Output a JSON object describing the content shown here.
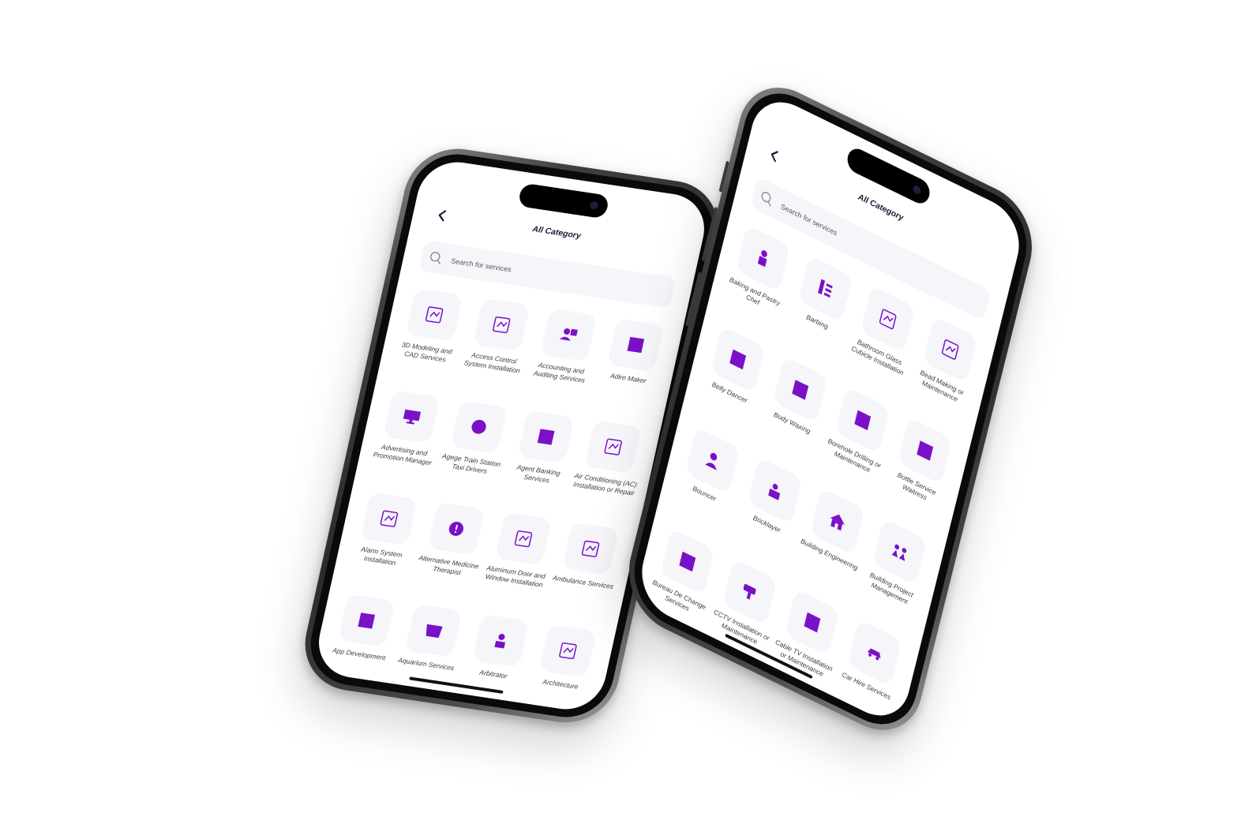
{
  "accent_color": "#7a11c7",
  "screens": [
    {
      "back_icon": "chevron-left-icon",
      "title": "All Category",
      "search": {
        "placeholder": "Search for services",
        "icon": "search-icon"
      },
      "categories": [
        {
          "label": "3D Modeling and CAD Services",
          "icon": "3d-modeling-icon"
        },
        {
          "label": "Access Control System Installation",
          "icon": "access-control-icon"
        },
        {
          "label": "Accounting and Auditing Services",
          "icon": "accounting-icon"
        },
        {
          "label": "Adire Maker",
          "icon": "square-icon"
        },
        {
          "label": "Advertising and Promotion Manager",
          "icon": "monitor-icon"
        },
        {
          "label": "Agege Train Station Taxi Drivers",
          "icon": "circle-icon"
        },
        {
          "label": "Agent Banking Services",
          "icon": "square-icon"
        },
        {
          "label": "Air Conditioning (AC) Installation or Repair",
          "icon": "air-conditioner-icon"
        },
        {
          "label": "Alarm System Installation",
          "icon": "alarm-system-icon"
        },
        {
          "label": "Alternative Medicine Therapist",
          "icon": "alert-circle-icon"
        },
        {
          "label": "Aluminum Door and Window Installation",
          "icon": "window-icon"
        },
        {
          "label": "Ambulance Services",
          "icon": "ambulance-icon"
        },
        {
          "label": "App Development",
          "icon": "square-icon"
        },
        {
          "label": "Aquarium Services",
          "icon": "aquarium-icon"
        },
        {
          "label": "Arbitrator",
          "icon": "arbitrator-icon"
        },
        {
          "label": "Architecture",
          "icon": "architecture-icon"
        }
      ]
    },
    {
      "back_icon": "chevron-left-icon",
      "title": "All Category",
      "search": {
        "placeholder": "Search for services",
        "icon": "search-icon"
      },
      "categories": [
        {
          "label": "Baking and Pastry Chef",
          "icon": "chef-icon"
        },
        {
          "label": "Barbing",
          "icon": "barbing-icon"
        },
        {
          "label": "Bathroom Glass Cubicle Installation",
          "icon": "bathroom-icon"
        },
        {
          "label": "Bead Making or Maintenance",
          "icon": "bead-icon"
        },
        {
          "label": "Belly Dancer",
          "icon": "square-icon"
        },
        {
          "label": "Body Waxing",
          "icon": "square-icon"
        },
        {
          "label": "Borehole Drilling or Maintenance",
          "icon": "square-icon"
        },
        {
          "label": "Bottle Service Waitress",
          "icon": "square-icon"
        },
        {
          "label": "Bouncer",
          "icon": "bouncer-icon"
        },
        {
          "label": "Bricklayer",
          "icon": "bricklayer-icon"
        },
        {
          "label": "Building Engineering",
          "icon": "house-icon"
        },
        {
          "label": "Building Project Management",
          "icon": "team-icon"
        },
        {
          "label": "Bureau De Change Services",
          "icon": "square-icon"
        },
        {
          "label": "CCTV Installation or Maintenance",
          "icon": "cctv-icon"
        },
        {
          "label": "Cable TV Installation or Maintenance",
          "icon": "square-icon"
        },
        {
          "label": "Car Hire Services",
          "icon": "car-icon"
        }
      ]
    }
  ]
}
